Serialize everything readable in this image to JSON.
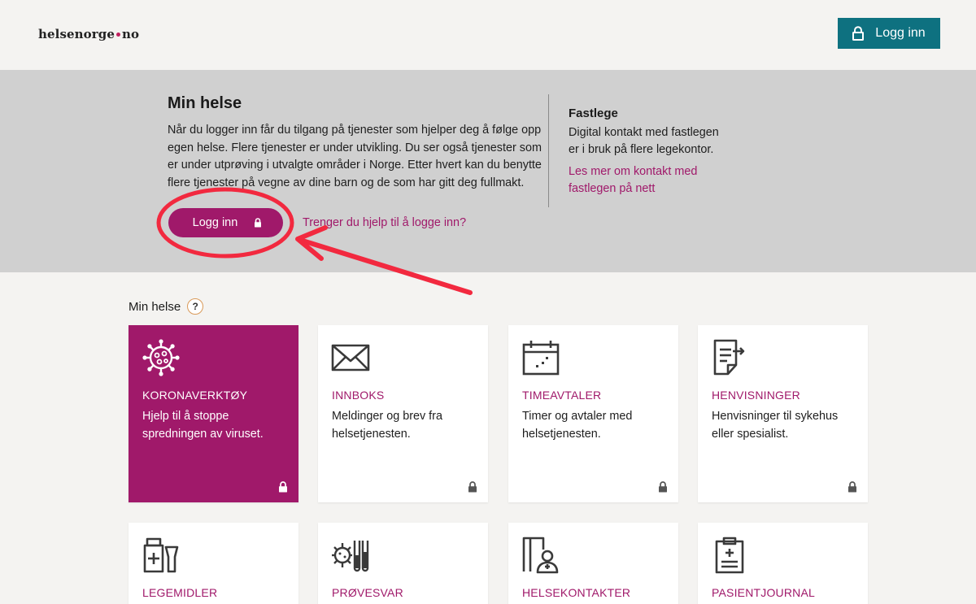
{
  "colors": {
    "brand_teal": "#0e7180",
    "brand_magenta": "#a0196a",
    "banner_bg": "#d0d0d0",
    "annotation_red": "#f2293f",
    "logo_dot": "#c0205e"
  },
  "header": {
    "logo_part1": "helsenorge",
    "logo_part2": "no",
    "login_label": "Logg inn",
    "login_icon": "lock-icon"
  },
  "banner": {
    "title": "Min helse",
    "text": "Når du logger inn får du tilgang på tjenester som hjelper deg å følge opp egen helse. Flere tjenester er under utvikling. Du ser også tjenester som er under utprøving i utvalgte områder i Norge. Etter hvert kan du benytte flere tjenester på vegne av dine barn og de som har gitt deg fullmakt.",
    "login_label": "Logg inn",
    "help_link": "Trenger du hjelp til å logge inn?",
    "fastlege_title": "Fastlege",
    "fastlege_text": "Digital kontakt med fastlegen er i bruk på flere legekontor.",
    "fastlege_link": "Les mer om kontakt med fastlegen på nett"
  },
  "section": {
    "title": "Min helse",
    "help_badge": "?"
  },
  "cards": [
    {
      "title": "KORONAVERKTØY",
      "desc": "Hjelp til å stoppe spredningen av viruset.",
      "icon": "virus-icon",
      "featured": true,
      "locked": true
    },
    {
      "title": "INNBOKS",
      "desc": "Meldinger og brev fra helsetjenesten.",
      "icon": "envelope-icon",
      "featured": false,
      "locked": true
    },
    {
      "title": "TIMEAVTALER",
      "desc": "Timer og avtaler med helsetjenesten.",
      "icon": "calendar-icon",
      "featured": false,
      "locked": true
    },
    {
      "title": "HENVISNINGER",
      "desc": "Henvisninger til sykehus eller spesialist.",
      "icon": "referral-document-icon",
      "featured": false,
      "locked": true
    },
    {
      "title": "LEGEMIDLER",
      "desc": "",
      "icon": "medicine-icon",
      "featured": false,
      "locked": false
    },
    {
      "title": "PRØVESVAR",
      "desc": "",
      "icon": "test-tubes-icon",
      "featured": false,
      "locked": false
    },
    {
      "title": "HELSEKONTAKTER",
      "desc": "",
      "icon": "health-contact-icon",
      "featured": false,
      "locked": false
    },
    {
      "title": "PASIENTJOURNAL",
      "desc": "",
      "icon": "clipboard-icon",
      "featured": false,
      "locked": false
    }
  ]
}
